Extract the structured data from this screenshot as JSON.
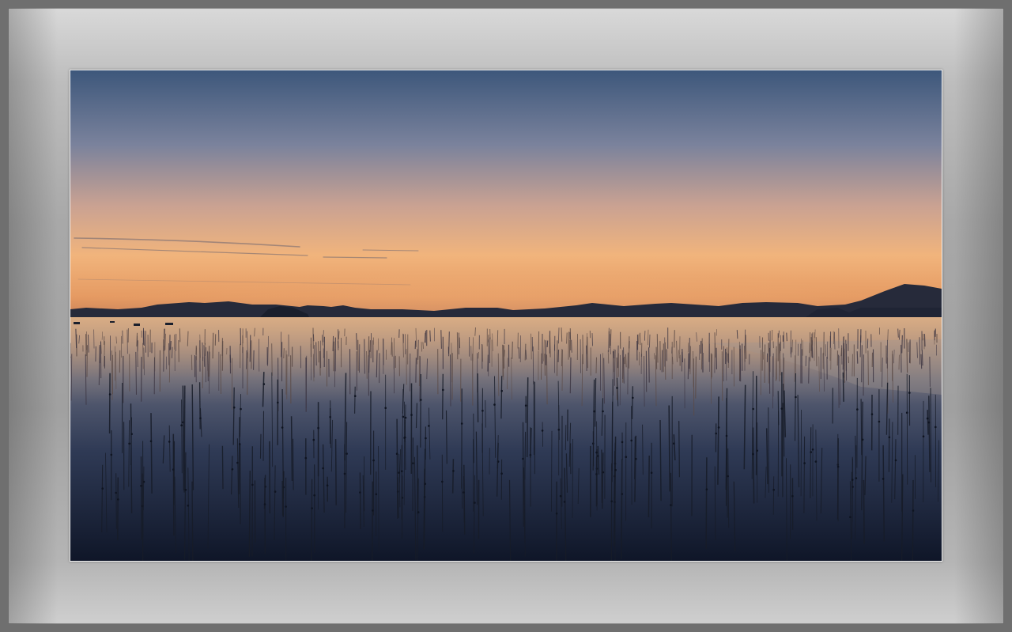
{
  "image": {
    "subject": "sunset-over-tidal-flat",
    "colors": {
      "sky_top": "#3f5a7e",
      "sky_mid": "#8b8ea6",
      "horizon_glow": "#f3b47a",
      "horizon_deep": "#d98a55",
      "water_top": "#c9a58a",
      "water_bottom": "#11182a",
      "silhouette": "#1c2232",
      "frame_light": "#d9d9d9",
      "frame_dark": "#7a7a7a"
    }
  }
}
